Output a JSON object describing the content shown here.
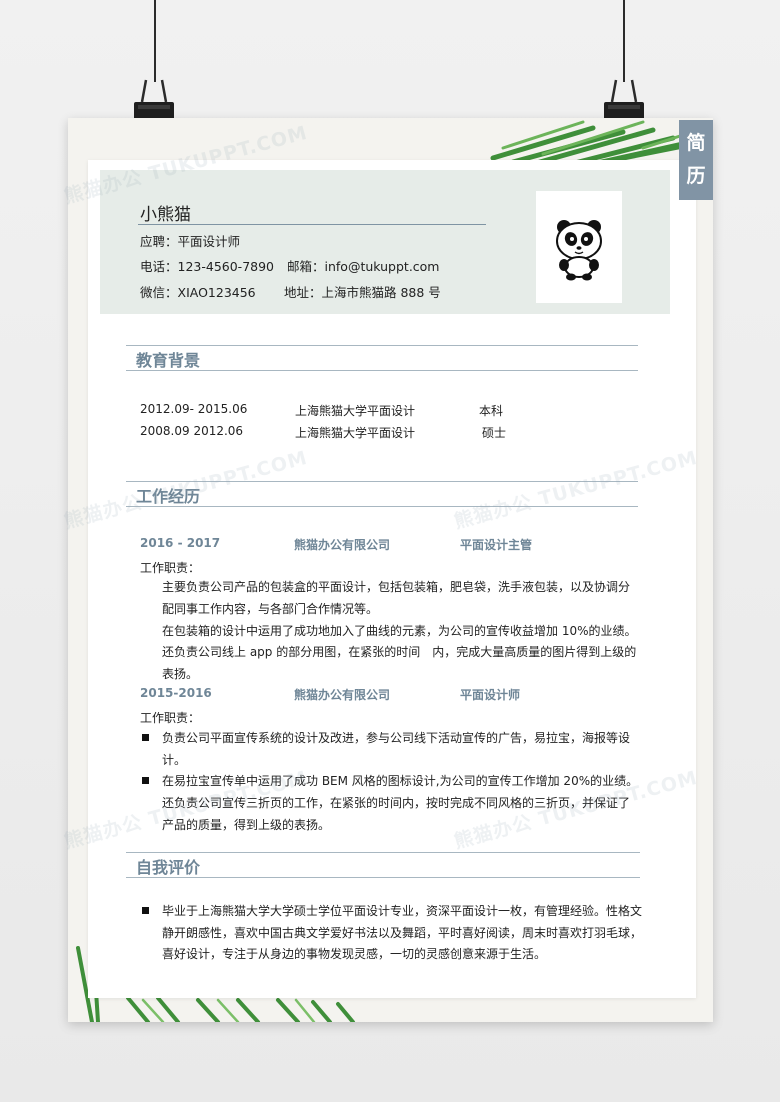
{
  "side_tag": [
    "简",
    "历"
  ],
  "name": "小熊猫",
  "apply": "应聘：平面设计师",
  "phone": "电话：123-4560-7890",
  "email": "邮箱：info@tukuppt.com",
  "wechat": "微信：XIAO123456",
  "address": "地址：上海市熊猫路 888 号",
  "watermark": "熊猫办公 TUKUPPT.COM",
  "education": {
    "title": "教育背景",
    "rows": [
      {
        "date": "2012.09- 2015.06",
        "school": "上海熊猫大学平面设计",
        "degree": "本科"
      },
      {
        "date": "2008.09 2012.06",
        "school": "上海熊猫大学平面设计",
        "degree": "硕士"
      }
    ]
  },
  "work": {
    "title": "工作经历",
    "jobs": [
      {
        "period": "2016 - 2017",
        "company": "熊猫办公有限公司",
        "position": "平面设计主管",
        "duty_label": "工作职责：",
        "lines": [
          "主要负责公司产品的包装盒的平面设计，包括包装箱，肥皂袋，洗手液包装，以及协调分",
          "配同事工作内容，与各部门合作情况等。",
          "在包装箱的设计中运用了成功地加入了曲线的元素，为公司的宣传收益增加 10%的业绩。",
          "还负责公司线上 app 的部分用图，在紧张的时间　内，完成大量高质量的图片得到上级的",
          "表扬。"
        ]
      },
      {
        "period": "2015-2016",
        "company": "熊猫办公有限公司",
        "position": "平面设计师",
        "duty_label": "工作职责：",
        "lines": [
          "负责公司平面宣传系统的设计及改进，参与公司线下活动宣传的广告，易拉宝，海报等设",
          "计。",
          "在易拉宝宣传单中运用了成功 BEM 风格的图标设计,为公司的宣传工作增加 20%的业绩。",
          "还负责公司宣传三折页的工作，在紧张的时间内，按时完成不同风格的三折页，并保证了",
          "产品的质量，得到上级的表扬。"
        ]
      }
    ]
  },
  "self": {
    "title": "自我评价",
    "lines": [
      "毕业于上海熊猫大学大学硕士学位平面设计专业，资深平面设计一枚，有管理经验。性格文",
      "静开朗感性，喜欢中国古典文学爱好书法以及舞蹈，平时喜好阅读，周末时喜欢打羽毛球，",
      "喜好设计，专注于从身边的事物发现灵感，一切的灵感创意来源于生活。"
    ]
  }
}
